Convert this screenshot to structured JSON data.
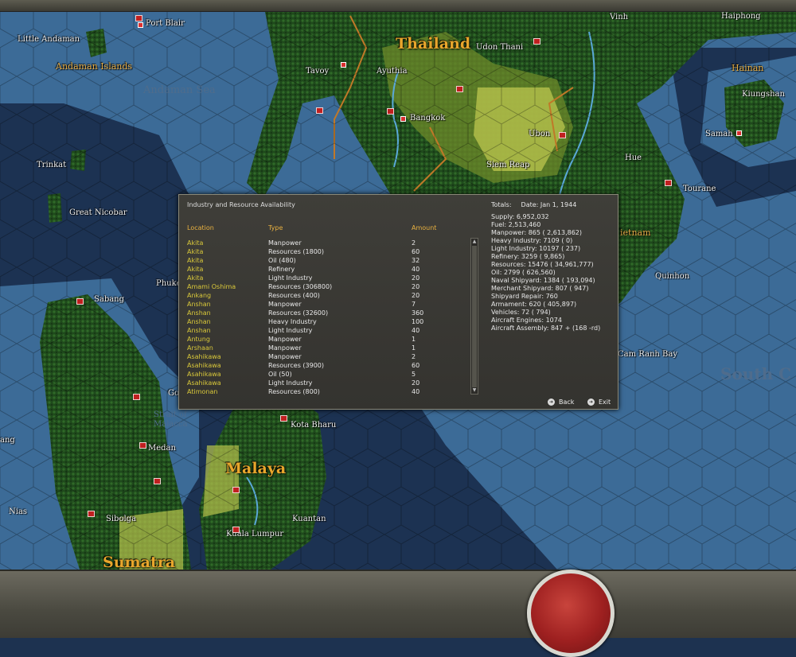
{
  "map": {
    "places": [
      {
        "id": "port-blair",
        "text": "Port Blair"
      },
      {
        "id": "little-andaman",
        "text": "Little Andaman"
      },
      {
        "id": "andaman-islands",
        "text": "Andaman Islands"
      },
      {
        "id": "andaman-sea",
        "text": "Andaman Sea"
      },
      {
        "id": "thailand",
        "text": "Thailand"
      },
      {
        "id": "udon-thani",
        "text": "Udon Thani"
      },
      {
        "id": "tavoy",
        "text": "Tavoy"
      },
      {
        "id": "ayuthia",
        "text": "Ayuthia"
      },
      {
        "id": "bangkok",
        "text": "Bangkok"
      },
      {
        "id": "ubon",
        "text": "Ubon"
      },
      {
        "id": "siem-reap",
        "text": "Siem Reap"
      },
      {
        "id": "vinh",
        "text": "Vinh"
      },
      {
        "id": "haiphong",
        "text": "Haiphong"
      },
      {
        "id": "hainan",
        "text": "Hainan"
      },
      {
        "id": "kiungshan",
        "text": "Kiungshan"
      },
      {
        "id": "samah",
        "text": "Samah"
      },
      {
        "id": "hue",
        "text": "Hue"
      },
      {
        "id": "tourane",
        "text": "Tourane"
      },
      {
        "id": "trinkat",
        "text": "Trinkat"
      },
      {
        "id": "great-nicobar",
        "text": "Great Nicobar"
      },
      {
        "id": "phuket",
        "text": "Phuke"
      },
      {
        "id": "vietnam",
        "text": "ietnam"
      },
      {
        "id": "quinhon",
        "text": "Quinhon"
      },
      {
        "id": "sabang",
        "text": "Sabang"
      },
      {
        "id": "cam-ranh-bay",
        "text": "Cam Ranh Bay"
      },
      {
        "id": "south-china-sea",
        "text": "South C"
      },
      {
        "id": "strait-of-malacca",
        "text": "Strait of\nMalacca"
      },
      {
        "id": "go",
        "text": "Go"
      },
      {
        "id": "kota-bharu",
        "text": "Kota Bharu"
      },
      {
        "id": "medan",
        "text": "Medan"
      },
      {
        "id": "ang",
        "text": "ang"
      },
      {
        "id": "malaya",
        "text": "Malaya"
      },
      {
        "id": "nias",
        "text": "Nias"
      },
      {
        "id": "sibolga",
        "text": "Sibolga"
      },
      {
        "id": "kuantan",
        "text": "Kuantan"
      },
      {
        "id": "kuala-lumpur",
        "text": "Kuala Lumpur"
      },
      {
        "id": "sumatra",
        "text": "Sumatra"
      }
    ]
  },
  "panel": {
    "title": "Industry and Resource Availability",
    "columns": {
      "location": "Location",
      "type": "Type",
      "amount": "Amount"
    },
    "rows": [
      {
        "location": "Akita",
        "type": "Manpower",
        "amount": "2"
      },
      {
        "location": "Akita",
        "type": "Resources  (1800)",
        "amount": "60"
      },
      {
        "location": "Akita",
        "type": "Oil  (480)",
        "amount": "32"
      },
      {
        "location": "Akita",
        "type": "Refinery",
        "amount": "40"
      },
      {
        "location": "Akita",
        "type": "Light Industry",
        "amount": "20"
      },
      {
        "location": "Amami Oshima",
        "type": "Resources  (306800)",
        "amount": "20"
      },
      {
        "location": "Ankang",
        "type": "Resources  (400)",
        "amount": "20"
      },
      {
        "location": "Anshan",
        "type": "Manpower",
        "amount": "7"
      },
      {
        "location": "Anshan",
        "type": "Resources  (32600)",
        "amount": "360"
      },
      {
        "location": "Anshan",
        "type": "Heavy Industry",
        "amount": "100"
      },
      {
        "location": "Anshan",
        "type": "Light Industry",
        "amount": "40"
      },
      {
        "location": "Antung",
        "type": "Manpower",
        "amount": "1"
      },
      {
        "location": "Arshaan",
        "type": "Manpower",
        "amount": "1"
      },
      {
        "location": "Asahikawa",
        "type": "Manpower",
        "amount": "2"
      },
      {
        "location": "Asahikawa",
        "type": "Resources  (3900)",
        "amount": "60"
      },
      {
        "location": "Asahikawa",
        "type": "Oil  (50)",
        "amount": "5"
      },
      {
        "location": "Asahikawa",
        "type": "Light Industry",
        "amount": "20"
      },
      {
        "location": "Atimonan",
        "type": "Resources  (800)",
        "amount": "40"
      }
    ],
    "totals_label": "Totals:",
    "date": "Date: Jan 1, 1944",
    "totals": [
      "Supply: 6,952,032",
      "Fuel: 2,513,460",
      "Manpower: 865  ( 2,613,862)",
      "Heavy Industry: 7109  ( 0)",
      "Light Industry: 10197  ( 237)",
      "Refinery: 3259  ( 9,865)",
      "Resources: 15476  ( 34,961,777)",
      "Oil: 2799  ( 626,560)",
      "Naval Shipyard: 1384  ( 193,094)",
      "Merchant Shipyard: 807  ( 947)",
      "Shipyard Repair: 760",
      "Armament: 620  ( 405,897)",
      "Vehicles: 72  ( 794)",
      "Aircraft Engines: 1074",
      "Aircraft Assembly: 847 + (168 -rd)"
    ],
    "back_label": "Back",
    "exit_label": "Exit"
  }
}
